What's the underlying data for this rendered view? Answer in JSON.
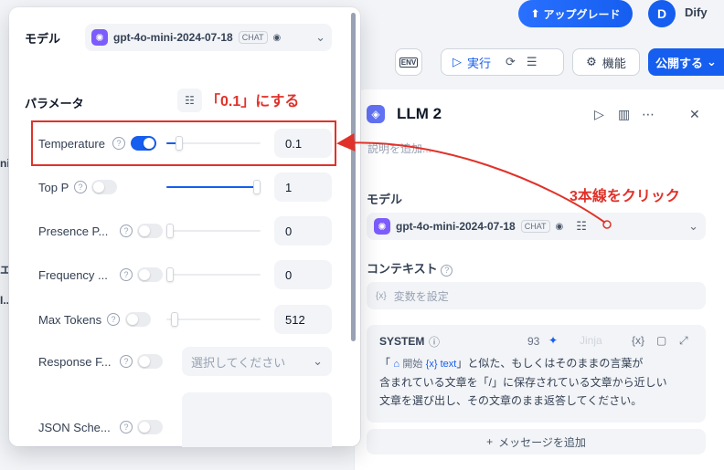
{
  "topbar": {
    "upgrade_label": "アップグレード",
    "user_initial": "D",
    "user_name": "Dify"
  },
  "toolbar": {
    "env_label": "ENV",
    "run_label": "実行",
    "features_label": "機能",
    "publish_label": "公開する"
  },
  "llm_panel": {
    "title": "LLM 2",
    "description_placeholder": "説明を追加...",
    "model_section_label": "モデル",
    "model_name": "gpt-4o-mini-2024-07-18",
    "model_badge": "CHAT",
    "context_section_label": "コンテキスト",
    "context_placeholder": "変数を設定",
    "system": {
      "label": "SYSTEM",
      "count": "93",
      "jinja_label": "Jinja",
      "line1_a": "「",
      "start_node": "開始",
      "var_text": "{x} text",
      "line1_b": "」と似た、もしくはそのままの言葉が",
      "line2": "含まれている文章を「/」に保存されている文章から近しい",
      "line3": "文章を選び出し、その文章のまま返答してください。"
    },
    "add_message_label": "メッセージを追加"
  },
  "popup": {
    "model_label": "モデル",
    "model_name": "gpt-4o-mini-2024-07-18",
    "model_badge": "CHAT",
    "params_label": "パラメータ",
    "params": [
      {
        "name": "Temperature",
        "enabled": true,
        "level": 0.1,
        "value": "0.1"
      },
      {
        "name": "Top P",
        "enabled": false,
        "level": 1.0,
        "value": "1"
      },
      {
        "name": "Presence P...",
        "enabled": false,
        "level": 0.0,
        "value": "0"
      },
      {
        "name": "Frequency ...",
        "enabled": false,
        "level": 0.0,
        "value": "0"
      },
      {
        "name": "Max Tokens",
        "enabled": false,
        "level": 0.05,
        "value": "512"
      }
    ],
    "response_format": {
      "name": "Response F...",
      "placeholder": "選択してください"
    },
    "json_schema": {
      "name": "JSON Sche..."
    }
  },
  "annotations": {
    "set_value_note": "「0.1」にする",
    "click_note": "3本線をクリック",
    "color": "#e0322a"
  }
}
